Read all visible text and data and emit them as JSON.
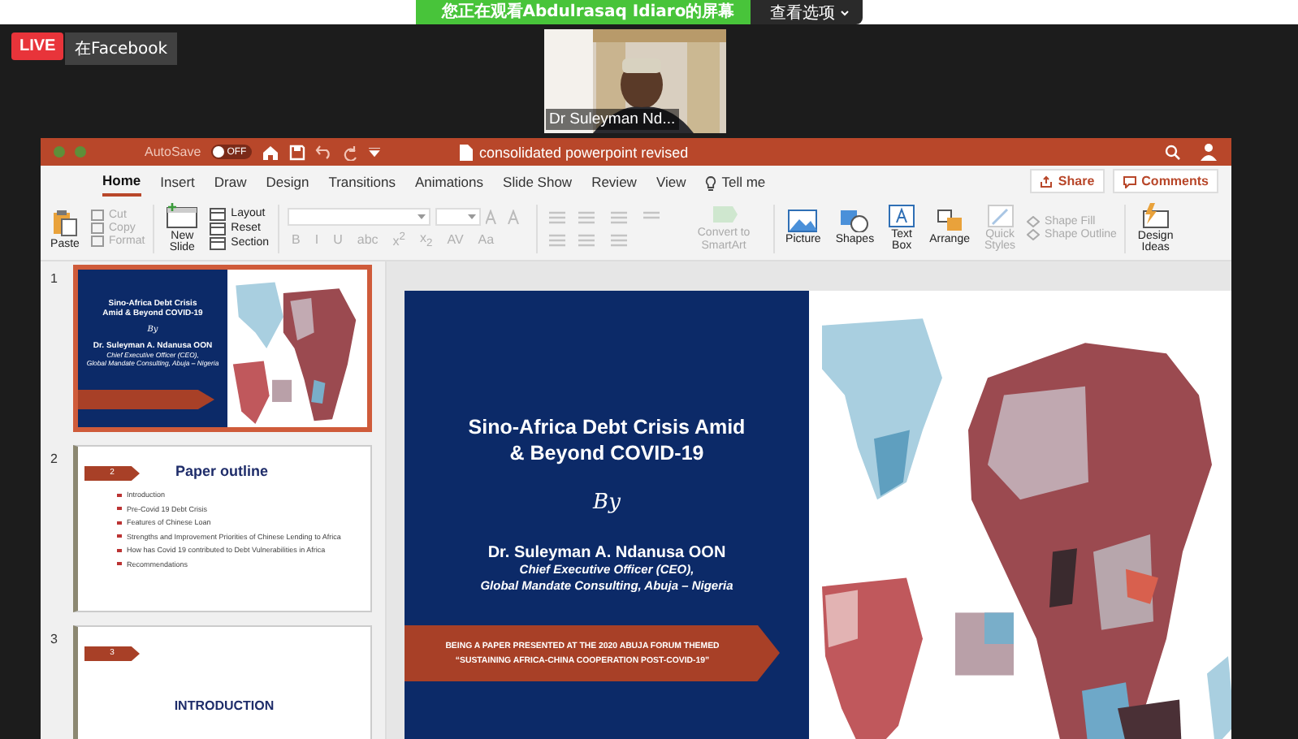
{
  "share_banner": {
    "text": "您正在观看Abdulrasaq  Idiaro的屏幕",
    "options_button": "查看选项"
  },
  "video_tile": {
    "name": "Dr Suleyman Nd..."
  },
  "live_badge": {
    "label": "LIVE",
    "destination": "在Facebook"
  },
  "titlebar": {
    "autosave_label": "AutoSave",
    "autosave": {
      "on": false,
      "text": "OFF"
    },
    "document_title": "consolidated powerpoint  revised"
  },
  "tabs": [
    {
      "label": "Home",
      "selected": true
    },
    {
      "label": "Insert",
      "selected": false
    },
    {
      "label": "Draw",
      "selected": false
    },
    {
      "label": "Design",
      "selected": false
    },
    {
      "label": "Transitions",
      "selected": false
    },
    {
      "label": "Animations",
      "selected": false
    },
    {
      "label": "Slide Show",
      "selected": false
    },
    {
      "label": "Review",
      "selected": false
    },
    {
      "label": "View",
      "selected": false
    }
  ],
  "tell_me": "Tell me",
  "share_button": "Share",
  "comments_button": "Comments",
  "ribbon": {
    "paste": {
      "label": "Paste",
      "disabled": false
    },
    "clipboard": [
      {
        "label": "Cut",
        "disabled": true
      },
      {
        "label": "Copy",
        "disabled": true
      },
      {
        "label": "Format",
        "disabled": true
      }
    ],
    "new_slide": {
      "label": "New\nSlide",
      "disabled": false
    },
    "slide_tools": [
      {
        "label": "Layout",
        "disabled": false
      },
      {
        "label": "Reset",
        "disabled": false
      },
      {
        "label": "Section",
        "disabled": false
      }
    ],
    "font_buttons": [
      {
        "label": "B",
        "disabled": true
      },
      {
        "label": "I",
        "disabled": true
      },
      {
        "label": "U",
        "disabled": true
      },
      {
        "label": "abc",
        "disabled": true
      },
      {
        "label": "x$^{2}$",
        "disabled": true
      },
      {
        "label": "x$_{2}$",
        "disabled": true
      },
      {
        "label": "AV",
        "disabled": true
      },
      {
        "label": "Aa",
        "disabled": true
      }
    ],
    "smartart": {
      "label": "Convert to\nSmartArt",
      "disabled": true
    },
    "insert": [
      {
        "label": "Picture",
        "kind": "picture",
        "disabled": false
      },
      {
        "label": "Shapes",
        "kind": "shapes",
        "disabled": false
      },
      {
        "label": "Text\nBox",
        "kind": "textbox",
        "disabled": false
      },
      {
        "label": "Arrange",
        "kind": "arrange",
        "disabled": false
      },
      {
        "label": "Quick\nStyles",
        "kind": "styles",
        "disabled": true
      }
    ],
    "shape_tools": [
      {
        "label": "Shape Fill",
        "disabled": true
      },
      {
        "label": "Shape Outline",
        "disabled": true
      }
    ],
    "design_ideas": {
      "label": "Design\nIdeas",
      "disabled": false
    }
  },
  "thumbnails": [
    {
      "number": "1",
      "selected": true,
      "kind": "title",
      "title": "Sino-Africa Debt Crisis Amid & Beyond COVID-19",
      "by": "By",
      "name": "Dr. Suleyman A. Ndanusa OON",
      "role_lines": [
        "Chief Executive Officer (CEO),",
        "Global Mandate Consulting, Abuja – Nigeria"
      ]
    },
    {
      "number": "2",
      "selected": false,
      "kind": "outline",
      "badge": "2",
      "title": "Paper outline",
      "bullets": [
        "Introduction",
        "Pre-Covid 19 Debt Crisis",
        "Features of Chinese Loan",
        "Strengths and Improvement Priorities of Chinese Lending to Africa",
        "How has Covid 19 contributed to Debt Vulnerabilities in Africa",
        "Recommendations"
      ]
    },
    {
      "number": "3",
      "selected": false,
      "kind": "section",
      "badge": "3",
      "title": "INTRODUCTION"
    }
  ],
  "slide": {
    "title_lines": [
      "Sino-Africa Debt Crisis Amid",
      "& Beyond COVID-19"
    ],
    "by": "By",
    "name": "Dr. Suleyman A. Ndanusa OON",
    "role_lines": [
      "Chief Executive Officer (CEO),",
      "Global Mandate Consulting, Abuja – Nigeria"
    ],
    "banner_lines": [
      "BEING A PAPER PRESENTED AT THE 2020 ABUJA FORUM THEMED",
      "“SUSTAINING AFRICA-CHINA COOPERATION POST-COVID-19”"
    ],
    "figure": {
      "kind": "picture"
    }
  }
}
